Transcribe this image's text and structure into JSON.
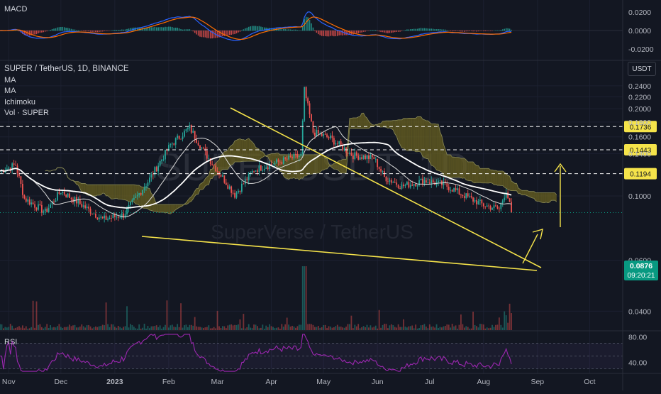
{
  "symbol": {
    "title": "SUPER / TetherUS, 1D, BINANCE",
    "watermark_main": "SUPERUSDT, 1D",
    "watermark_sub": "SuperVerse / TetherUS",
    "currency_button": "USDT",
    "last_price": "0.0876",
    "countdown": "09:20:21"
  },
  "indicators": [
    "MA",
    "MA",
    "Ichimoku",
    "Vol · SUPER"
  ],
  "panes": {
    "macd_label": "MACD",
    "rsi_label": "RSI"
  },
  "colors": {
    "background": "#131722",
    "up": "#26a69a",
    "down": "#ef5350",
    "trendline": "#f5e34a",
    "cloud": "#6b6322",
    "ma_white": "#ffffff",
    "macd": "#2962ff",
    "signal": "#ff6d00",
    "rsi": "#9c27b0",
    "price_badge": "#089981"
  },
  "chart_data": [
    {
      "type": "line",
      "name": "price",
      "y_scale": "log",
      "ylim": [
        0.035,
        0.27
      ],
      "ytick_labels": [
        "0.2400",
        "0.2200",
        "0.2000",
        "0.1800",
        "0.1600",
        "0.1400",
        "0.1000",
        "0.0600",
        "0.0400"
      ],
      "xtick_labels": [
        "Nov",
        "Dec",
        "2023",
        "Feb",
        "Mar",
        "Apr",
        "May",
        "Jun",
        "Jul",
        "Aug",
        "Sep",
        "Oct"
      ],
      "date_range": [
        "2022-10-27",
        "2023-10-20"
      ],
      "horizontal_levels": [
        {
          "value": 0.1736,
          "label": "0.1736"
        },
        {
          "value": 0.1443,
          "label": "0.1443"
        },
        {
          "value": 0.1194,
          "label": "0.1194"
        }
      ],
      "approx_close_path": [
        {
          "date": "2022-10-27",
          "close": 0.122
        },
        {
          "date": "2022-11-05",
          "close": 0.128
        },
        {
          "date": "2022-11-10",
          "close": 0.098
        },
        {
          "date": "2022-11-22",
          "close": 0.088
        },
        {
          "date": "2022-12-01",
          "close": 0.104
        },
        {
          "date": "2022-12-12",
          "close": 0.094
        },
        {
          "date": "2022-12-25",
          "close": 0.083
        },
        {
          "date": "2023-01-06",
          "close": 0.086
        },
        {
          "date": "2023-01-20",
          "close": 0.112
        },
        {
          "date": "2023-02-02",
          "close": 0.15
        },
        {
          "date": "2023-02-13",
          "close": 0.172
        },
        {
          "date": "2023-02-22",
          "close": 0.14
        },
        {
          "date": "2023-03-03",
          "close": 0.118
        },
        {
          "date": "2023-03-11",
          "close": 0.101
        },
        {
          "date": "2023-03-22",
          "close": 0.123
        },
        {
          "date": "2023-04-05",
          "close": 0.131
        },
        {
          "date": "2023-04-18",
          "close": 0.138
        },
        {
          "date": "2023-04-20",
          "close": 0.232
        },
        {
          "date": "2023-04-25",
          "close": 0.166
        },
        {
          "date": "2023-05-05",
          "close": 0.158
        },
        {
          "date": "2023-05-18",
          "close": 0.138
        },
        {
          "date": "2023-05-30",
          "close": 0.135
        },
        {
          "date": "2023-06-05",
          "close": 0.116
        },
        {
          "date": "2023-06-15",
          "close": 0.108
        },
        {
          "date": "2023-06-28",
          "close": 0.113
        },
        {
          "date": "2023-07-10",
          "close": 0.109
        },
        {
          "date": "2023-07-20",
          "close": 0.101
        },
        {
          "date": "2023-08-01",
          "close": 0.093
        },
        {
          "date": "2023-08-10",
          "close": 0.09
        },
        {
          "date": "2023-08-14",
          "close": 0.105
        },
        {
          "date": "2023-08-17",
          "close": 0.0876
        }
      ]
    },
    {
      "type": "line",
      "name": "MACD",
      "ylim": [
        -0.03,
        0.03
      ],
      "ytick_labels": [
        "0.0200",
        "0.0000",
        "-0.0200"
      ]
    },
    {
      "type": "line",
      "name": "RSI",
      "ylim": [
        25,
        85
      ],
      "ytick_labels": [
        "80.00",
        "40.00"
      ]
    }
  ]
}
